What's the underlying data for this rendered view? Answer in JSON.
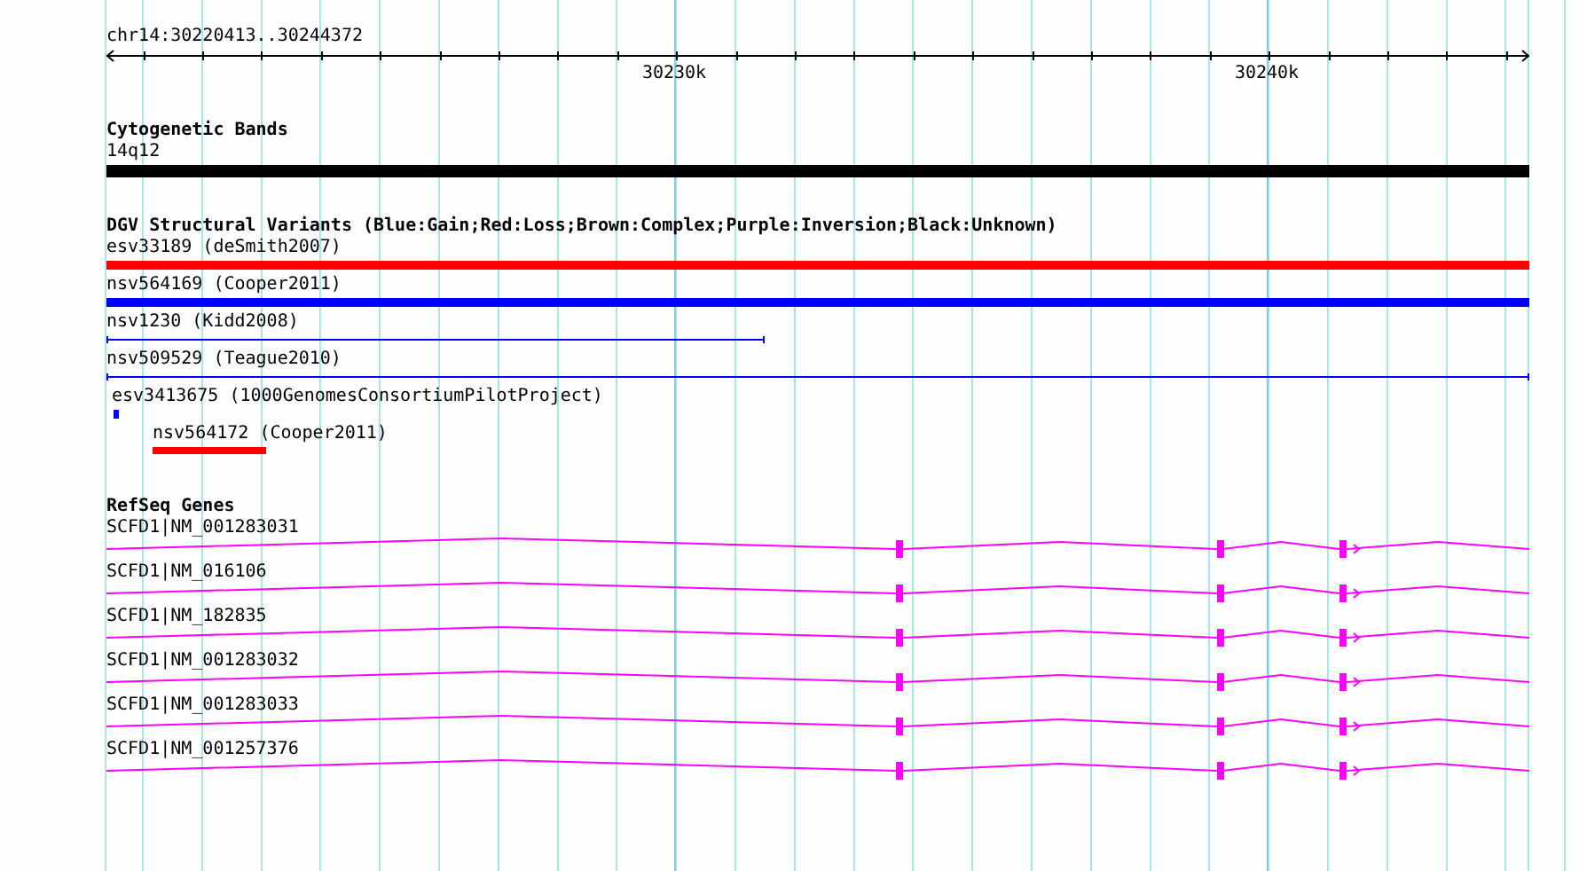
{
  "ruler": {
    "range": "chr14:30220413..30244372",
    "ticks": [
      "30230k",
      "30240k"
    ]
  },
  "tracks": [
    {
      "kind": "bands",
      "title": "Cytogenetic Bands",
      "features": [
        {
          "label": "14q12"
        }
      ]
    },
    {
      "kind": "variants",
      "title": "DGV Structural Variants (Blue:Gain;Red:Loss;Brown:Complex;Purple:Inversion;Black:Unknown)",
      "features": [
        {
          "label": "esv33189 (deSmith2007)",
          "kind": "bar",
          "color": "#ff0000"
        },
        {
          "label": "nsv564169 (Cooper2011)",
          "kind": "bar",
          "color": "#0000ff"
        },
        {
          "label": "nsv1230 (Kidd2008)",
          "kind": "line",
          "color": "#0000ff"
        },
        {
          "label": "nsv509529 (Teague2010)",
          "kind": "line",
          "color": "#0000ff"
        },
        {
          "label": "esv3413675 (1000GenomesConsortiumPilotProject)",
          "kind": "bar",
          "color": "#0000ff"
        },
        {
          "label": "nsv564172 (Cooper2011)",
          "kind": "bar",
          "color": "#ff0000"
        }
      ]
    },
    {
      "kind": "genes",
      "title": "RefSeq Genes",
      "features": [
        {
          "label": "SCFD1|NM_001283031"
        },
        {
          "label": "SCFD1|NM_016106"
        },
        {
          "label": "SCFD1|NM_182835"
        },
        {
          "label": "SCFD1|NM_001283032"
        },
        {
          "label": "SCFD1|NM_001283033"
        },
        {
          "label": "SCFD1|NM_001257376"
        }
      ]
    }
  ]
}
